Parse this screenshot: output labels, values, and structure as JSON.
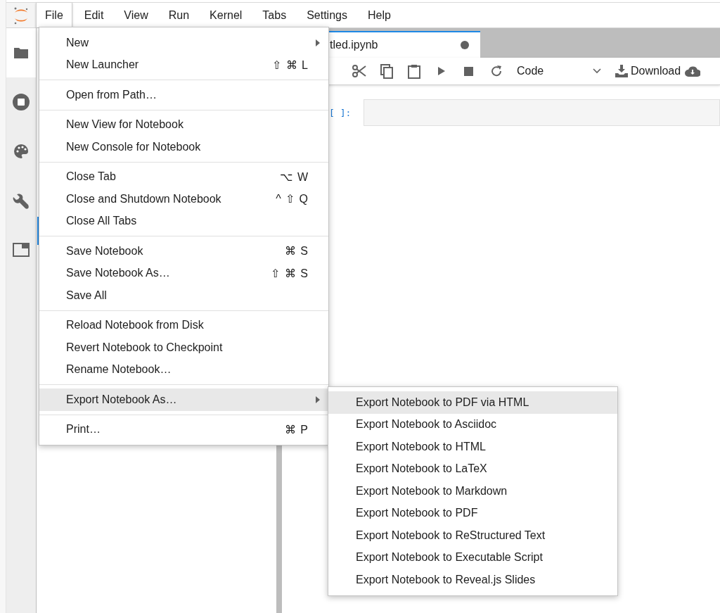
{
  "menubar": {
    "items": [
      {
        "label": "File",
        "selected": true
      },
      {
        "label": "Edit",
        "selected": false
      },
      {
        "label": "View",
        "selected": false
      },
      {
        "label": "Run",
        "selected": false
      },
      {
        "label": "Kernel",
        "selected": false
      },
      {
        "label": "Tabs",
        "selected": false
      },
      {
        "label": "Settings",
        "selected": false
      },
      {
        "label": "Help",
        "selected": false
      }
    ]
  },
  "sidebar": {
    "tabs": [
      {
        "kind": "folder",
        "selected": true
      },
      {
        "kind": "running",
        "selected": false
      },
      {
        "kind": "palette",
        "selected": false
      },
      {
        "kind": "wrench",
        "selected": false
      },
      {
        "kind": "tabs",
        "selected": false
      }
    ]
  },
  "document_tab": {
    "label": "tled.ipynb",
    "modified": true
  },
  "toolbar": {
    "cell_type": "Code",
    "download_label": "Download"
  },
  "cell": {
    "prompt": "[ ]:"
  },
  "file_menu": {
    "groups": [
      [
        {
          "label": "New",
          "has_submenu": true,
          "selected": false
        },
        {
          "label": "New Launcher",
          "shortcut": "⇧ ⌘ L",
          "selected": false
        }
      ],
      [
        {
          "label": "Open from Path…",
          "selected": false
        }
      ],
      [
        {
          "label": "New View for Notebook",
          "selected": false
        },
        {
          "label": "New Console for Notebook",
          "selected": false
        }
      ],
      [
        {
          "label": "Close Tab",
          "shortcut": "⌥ W",
          "selected": false
        },
        {
          "label": "Close and Shutdown Notebook",
          "shortcut": "^ ⇧ Q",
          "selected": false
        },
        {
          "label": "Close All Tabs",
          "selected": false
        }
      ],
      [
        {
          "label": "Save Notebook",
          "shortcut": "⌘ S",
          "selected": false
        },
        {
          "label": "Save Notebook As…",
          "shortcut": "⇧ ⌘ S",
          "selected": false
        },
        {
          "label": "Save All",
          "selected": false
        }
      ],
      [
        {
          "label": "Reload Notebook from Disk",
          "selected": false
        },
        {
          "label": "Revert Notebook to Checkpoint",
          "selected": false
        },
        {
          "label": "Rename Notebook…",
          "selected": false
        }
      ],
      [
        {
          "label": "Export Notebook As…",
          "has_submenu": true,
          "selected": true
        }
      ],
      [
        {
          "label": "Print…",
          "shortcut": "⌘ P",
          "selected": false
        }
      ]
    ]
  },
  "export_submenu": {
    "items": [
      {
        "label": "Export Notebook to PDF via HTML",
        "selected": true
      },
      {
        "label": "Export Notebook to Asciidoc",
        "selected": false
      },
      {
        "label": "Export Notebook to HTML",
        "selected": false
      },
      {
        "label": "Export Notebook to LaTeX",
        "selected": false
      },
      {
        "label": "Export Notebook to Markdown",
        "selected": false
      },
      {
        "label": "Export Notebook to PDF",
        "selected": false
      },
      {
        "label": "Export Notebook to ReStructured Text",
        "selected": false
      },
      {
        "label": "Export Notebook to Executable Script",
        "selected": false
      },
      {
        "label": "Export Notebook to Reveal.js Slides",
        "selected": false
      }
    ]
  }
}
